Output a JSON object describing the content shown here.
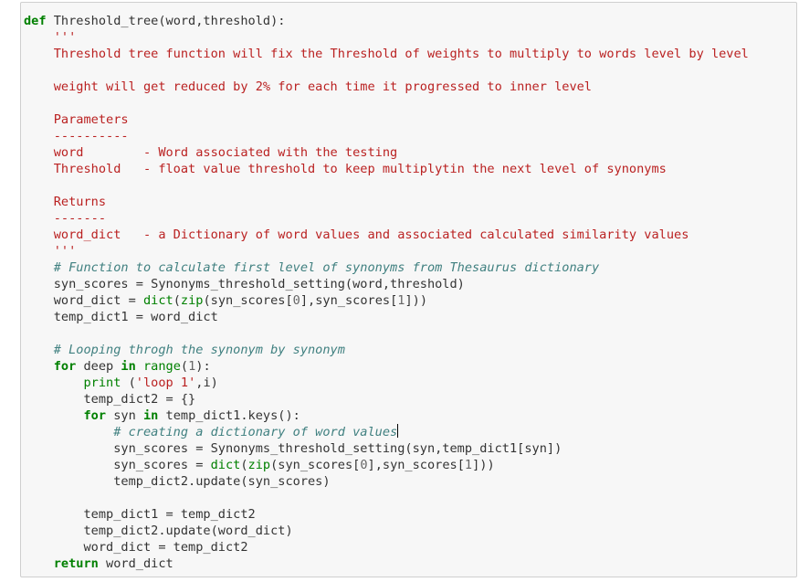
{
  "code_cell": {
    "lines": {
      "l1": {
        "kw": "def",
        "rest": " Threshold_tree(word,threshold):"
      },
      "l2": "    '''",
      "l3": "    Threshold tree function will fix the Threshold of weights to multiply to words level by level",
      "l4": "",
      "l5": "    weight will get reduced by 2% for each time it progressed to inner level",
      "l6": "",
      "l7": "    Parameters",
      "l8": "    ----------",
      "l9": "    word        - Word associated with the testing",
      "l10": "    Threshold   - float value threshold to keep multiplytin the next level of synonyms",
      "l11": "",
      "l12": "    Returns",
      "l13": "    -------",
      "l14": "    word_dict   - a Dictionary of word values and associated calculated similarity values",
      "l15": "    '''",
      "l16": "    # Function to calculate first level of synonyms from Thesaurus dictionary",
      "l17": "    syn_scores = Synonyms_threshold_setting(word,threshold)",
      "l18": {
        "a": "    word_dict = ",
        "b": "dict",
        "c": "(",
        "d": "zip",
        "e": "(syn_scores[",
        "f": "0",
        "g": "],syn_scores[",
        "h": "1",
        "i": "]))"
      },
      "l19": "    temp_dict1 = word_dict",
      "l20": "",
      "l21": "    # Looping throgh the synonym by synonym",
      "l22": {
        "a": "    ",
        "kw1": "for",
        "b": " deep ",
        "kw2": "in",
        "c": " ",
        "d": "range",
        "e": "(",
        "f": "1",
        "g": "):"
      },
      "l23": {
        "a": "        ",
        "b": "print",
        "c": " (",
        "d": "'loop 1'",
        "e": ",i)"
      },
      "l24": "        temp_dict2 = {}",
      "l25": {
        "a": "        ",
        "kw1": "for",
        "b": " syn ",
        "kw2": "in",
        "c": " temp_dict1.keys():"
      },
      "l26": "            # creating a dictionary of word values",
      "l27": "            syn_scores = Synonyms_threshold_setting(syn,temp_dict1[syn])",
      "l28": {
        "a": "            syn_scores = ",
        "b": "dict",
        "c": "(",
        "d": "zip",
        "e": "(syn_scores[",
        "f": "0",
        "g": "],syn_scores[",
        "h": "1",
        "i": "]))"
      },
      "l29": "            temp_dict2.update(syn_scores)",
      "l30": "",
      "l31": "        temp_dict1 = temp_dict2",
      "l32": "        temp_dict2.update(word_dict)",
      "l33": "        word_dict = temp_dict2",
      "l34": {
        "a": "    ",
        "kw": "return",
        "b": " word_dict"
      }
    }
  }
}
